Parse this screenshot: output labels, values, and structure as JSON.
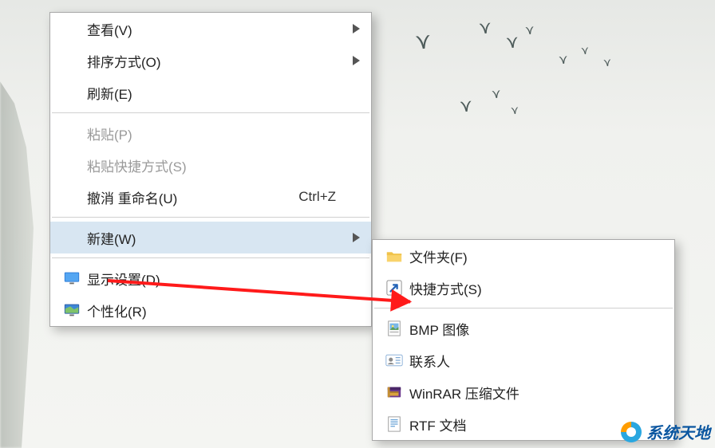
{
  "mainMenu": {
    "view": "查看(V)",
    "sort": "排序方式(O)",
    "refresh": "刷新(E)",
    "paste": "粘贴(P)",
    "pasteShortcut": "粘贴快捷方式(S)",
    "undo": "撤消 重命名(U)",
    "undoAccel": "Ctrl+Z",
    "new": "新建(W)",
    "display": "显示设置(D)",
    "personalize": "个性化(R)"
  },
  "subMenu": {
    "folder": "文件夹(F)",
    "shortcut": "快捷方式(S)",
    "bmp": "BMP 图像",
    "contact": "联系人",
    "winrar": "WinRAR 压缩文件",
    "rtf": "RTF 文档"
  },
  "watermark": "系统天地"
}
